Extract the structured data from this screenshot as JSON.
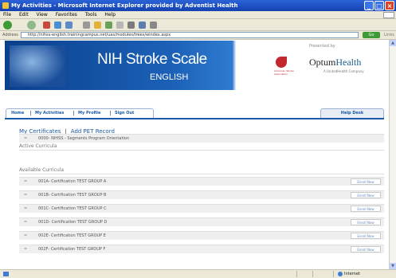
{
  "window": {
    "title": "My Activities - Microsoft Internet Explorer provided by Adventist Health"
  },
  "menu": [
    "File",
    "Edit",
    "View",
    "Favorites",
    "Tools",
    "Help"
  ],
  "address": {
    "label": "Address",
    "url": "http://nihss-english.trainingcampus.net/uas/modules/trees/windex.aspx",
    "go": "Go",
    "links": "Links"
  },
  "banner": {
    "title": "NIH Stroke Scale",
    "subtitle": "ENGLISH",
    "presented_by": "Presented by",
    "logo1_text": "American Stroke Association",
    "logo2_a": "Optum",
    "logo2_b": "Health",
    "logo2_sub": "A UnitedHealth Company"
  },
  "nav": {
    "home": "Home",
    "activities": "My Activities",
    "profile": "My Profile",
    "signout": "Sign Out",
    "help": "Help Desk"
  },
  "links": {
    "certificates": "My Certificates",
    "add_pet": "Add PET Record"
  },
  "active": {
    "label": "Active Curricula",
    "items": [
      {
        "name": "0000- NIHSS - Segments Program Orientation"
      }
    ]
  },
  "available": {
    "label": "Available Curricula",
    "enroll_label": "Enroll Now",
    "items": [
      {
        "name": "001A- Certification TEST GROUP A"
      },
      {
        "name": "001B- Certification TEST GROUP B"
      },
      {
        "name": "001C- Certification TEST GROUP C"
      },
      {
        "name": "001D- Certification TEST GROUP D"
      },
      {
        "name": "002E- Certification TEST GROUP E"
      },
      {
        "name": "002F- Certification TEST GROUP F"
      }
    ]
  },
  "status": {
    "zone": "Internet"
  },
  "colors": {
    "title_bar": "#1f53c8",
    "banner": "#1c62b8",
    "link": "#1b5aa8"
  }
}
